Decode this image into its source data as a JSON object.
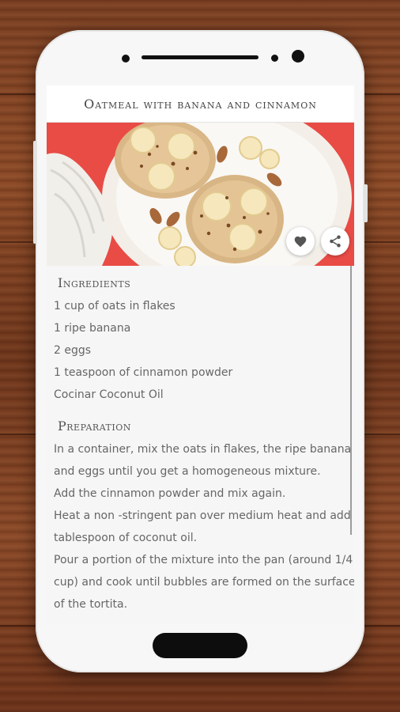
{
  "app": {
    "title": "Oatmeal with banana and cinnamon"
  },
  "image": {
    "alt": "Oatmeal pancakes with banana slices, almonds and cinnamon on a white plate"
  },
  "actions": {
    "favorite_icon": "heart-icon",
    "share_icon": "share-icon"
  },
  "ingredients": {
    "heading": "Ingredients",
    "items": [
      "1 cup of oats in flakes",
      "1 ripe banana",
      "2 eggs",
      "1 teaspoon of cinnamon powder",
      "Cocinar Coconut Oil"
    ]
  },
  "preparation": {
    "heading": "Preparation",
    "lines": [
      "In a container, mix the oats in flakes, the ripe banana",
      "and eggs until you get a homogeneous mixture.",
      "Add the cinnamon powder and mix again.",
      "Heat a non -stringent pan over medium heat and add a",
      "tablespoon of coconut oil.",
      "Pour a portion of the mixture into the pan (around 1/4",
      "cup) and cook until bubbles are formed on the surface",
      "of the tortita."
    ]
  },
  "colors": {
    "background_red": "#e94b45",
    "text": "#666666",
    "heading": "#555555"
  }
}
